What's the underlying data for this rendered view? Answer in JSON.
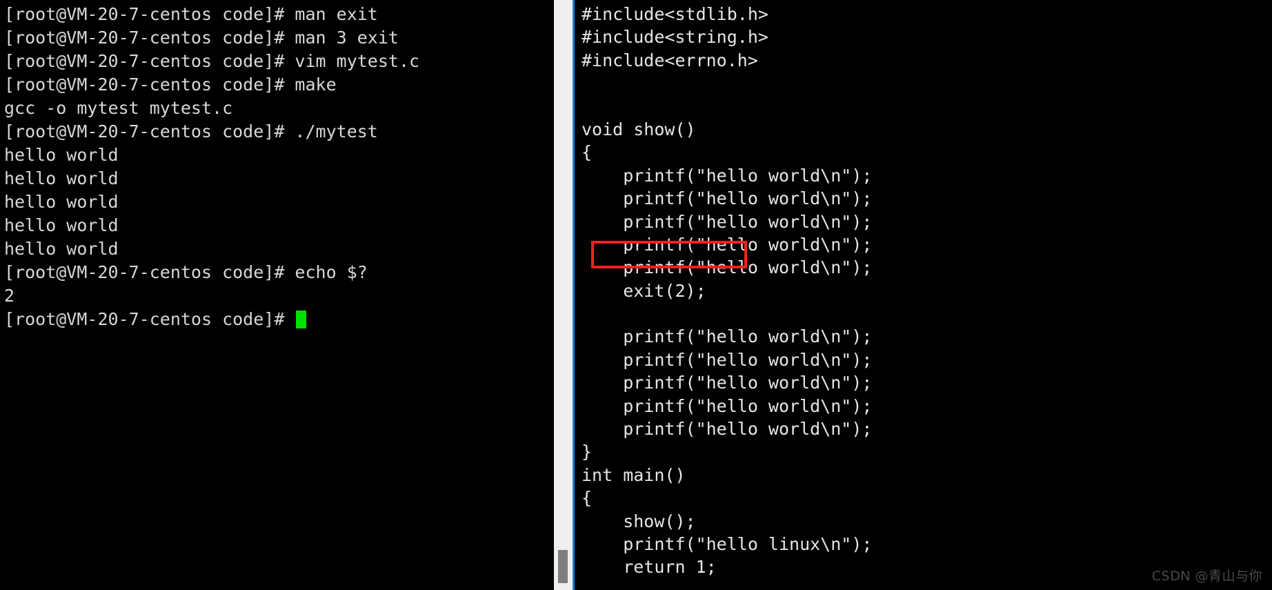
{
  "terminal": {
    "lines": [
      "[root@VM-20-7-centos code]# man exit",
      "[root@VM-20-7-centos code]# man 3 exit",
      "[root@VM-20-7-centos code]# vim mytest.c",
      "[root@VM-20-7-centos code]# make",
      "gcc -o mytest mytest.c",
      "[root@VM-20-7-centos code]# ./mytest",
      "hello world",
      "hello world",
      "hello world",
      "hello world",
      "hello world",
      "[root@VM-20-7-centos code]# echo $?",
      "2"
    ],
    "final_prompt": "[root@VM-20-7-centos code]# ",
    "cursor_color": "#00e000",
    "text_color": "#d8d8d8",
    "background": "#000000"
  },
  "divider": {
    "track_color": "#efefef",
    "thumb_color": "#7e7e7e",
    "border_color": "#1a7fd4"
  },
  "editor": {
    "background": "#000000",
    "text_color": "#e6e6e6",
    "lines": [
      "#include<stdlib.h>",
      "#include<string.h>",
      "#include<errno.h>",
      "",
      "",
      "void show()",
      "{",
      "    printf(\"hello world\\n\");",
      "    printf(\"hello world\\n\");",
      "    printf(\"hello world\\n\");",
      "    printf(\"hello world\\n\");",
      "    printf(\"hello world\\n\");",
      "    exit(2);",
      "",
      "    printf(\"hello world\\n\");",
      "    printf(\"hello world\\n\");",
      "    printf(\"hello world\\n\");",
      "    printf(\"hello world\\n\");",
      "    printf(\"hello world\\n\");",
      "}",
      "int main()",
      "{",
      "    show();",
      "    printf(\"hello linux\\n\");",
      "    return 1;"
    ],
    "highlight": {
      "label": "exit(2);",
      "color": "#ff2020"
    }
  },
  "watermark": {
    "text": "CSDN @青山与你",
    "color": "#4a4a4a"
  }
}
